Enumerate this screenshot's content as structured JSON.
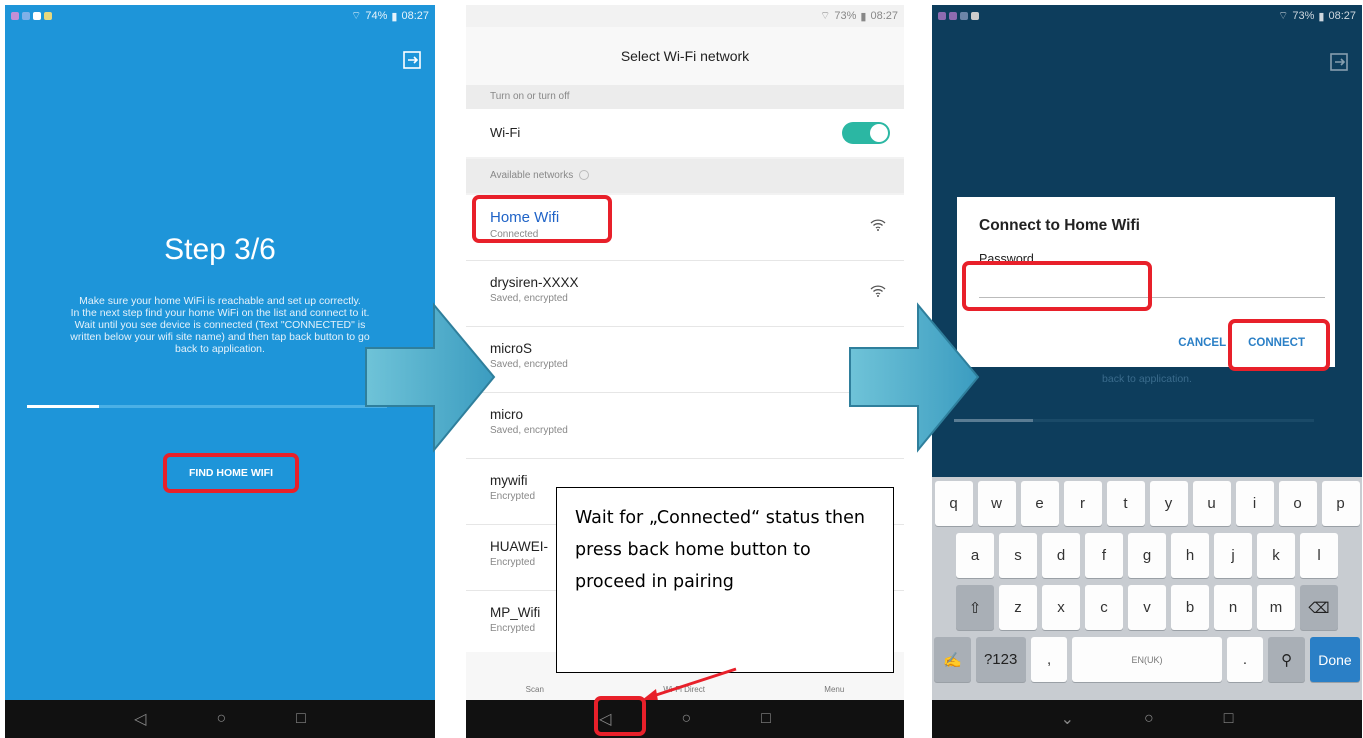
{
  "phone1": {
    "status": {
      "battery": "74%",
      "time": "08:27"
    },
    "title": "Step 3/6",
    "description": "Make sure your home WiFi is reachable and set up correctly.\nIn the next step find your home WiFi on the list and connect to it.\nWait until you see device is connected (Text \"CONNECTED\" is\nwritten below your wifi site name) and then tap back button to go\nback to application.",
    "progress": 0.2,
    "button": "FIND HOME WIFI"
  },
  "phone2": {
    "status": {
      "battery": "73%",
      "time": "08:27"
    },
    "header": "Select Wi-Fi network",
    "toggle_section": "Turn on or turn off",
    "wifi_label": "Wi-Fi",
    "wifi_on": true,
    "available_section": "Available networks",
    "networks": [
      {
        "name": "Home Wifi",
        "status": "Connected"
      },
      {
        "name": "drysiren-XXXX",
        "status": "Saved, encrypted"
      },
      {
        "name": "microS",
        "status": "Saved, encrypted"
      },
      {
        "name": "micro",
        "status": "Saved, encrypted"
      },
      {
        "name": "mywifi",
        "status": "Encrypted"
      },
      {
        "name": "HUAWEI-",
        "status": "Encrypted"
      },
      {
        "name": "MP_Wifi",
        "status": "Encrypted"
      }
    ],
    "bottom_tabs": [
      "Scan",
      "Wi-Fi Direct",
      "Menu"
    ],
    "callout": "Wait for „Connected“ status then press back home button to proceed in pairing"
  },
  "phone3": {
    "status": {
      "battery": "73%",
      "time": "08:27"
    },
    "dialog_title": "Connect to Home Wifi",
    "password_label": "Password",
    "cancel": "CANCEL",
    "connect": "CONNECT",
    "behind_text": "back to application.",
    "keyboard": {
      "row1": [
        "q",
        "w",
        "e",
        "r",
        "t",
        "y",
        "u",
        "i",
        "o",
        "p"
      ],
      "row2": [
        "a",
        "s",
        "d",
        "f",
        "g",
        "h",
        "j",
        "k",
        "l"
      ],
      "row3": [
        "z",
        "x",
        "c",
        "v",
        "b",
        "n",
        "m"
      ],
      "symbols": "?123",
      "space": "EN(UK)",
      "done": "Done"
    }
  }
}
